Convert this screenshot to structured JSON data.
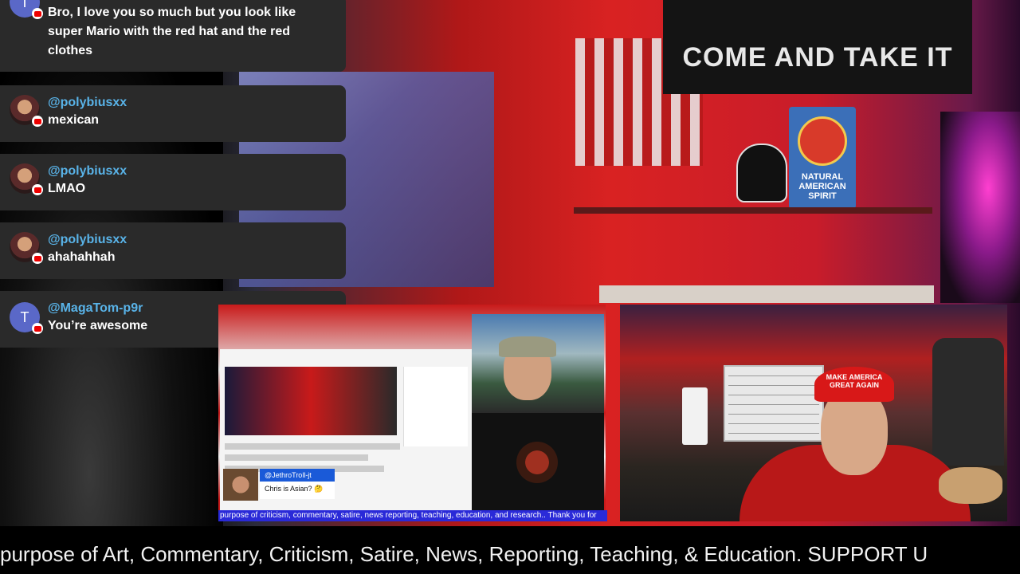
{
  "background": {
    "flag_text": "COME AND TAKE IT",
    "sign_text": "NATURAL AMERICAN SPIRIT"
  },
  "chat": {
    "messages": [
      {
        "user": "",
        "avatar": "T",
        "text": "Bro, I love you so much but you look like super Mario with the red hat and the red clothes"
      },
      {
        "user": "@polybiusxx",
        "avatar": "photo",
        "text": "mexican"
      },
      {
        "user": "@polybiusxx",
        "avatar": "photo",
        "text": "LMAO"
      },
      {
        "user": "@polybiusxx",
        "avatar": "photo",
        "text": "ahahahhah"
      },
      {
        "user": "@MagaTom-p9r",
        "avatar": "T",
        "text": "You’re awesome"
      }
    ]
  },
  "left_video": {
    "super_chat_name": "@JethroTroll-jt",
    "super_chat_text": "Chris is Asian? 🤔",
    "ticker": "purpose of criticism, commentary, satire, news reporting, teaching, education, and research.. Thank you for"
  },
  "right_video": {
    "hat_text": "MAKE AMERICA GREAT AGAIN"
  },
  "ticker": {
    "text": "purpose of Art, Commentary, Criticism, Satire, News, Reporting, Teaching, & Education. SUPPORT U"
  },
  "colors": {
    "chat_bg": "#2a2a2a",
    "username": "#59b3e8",
    "youtube_red": "#e00000"
  }
}
